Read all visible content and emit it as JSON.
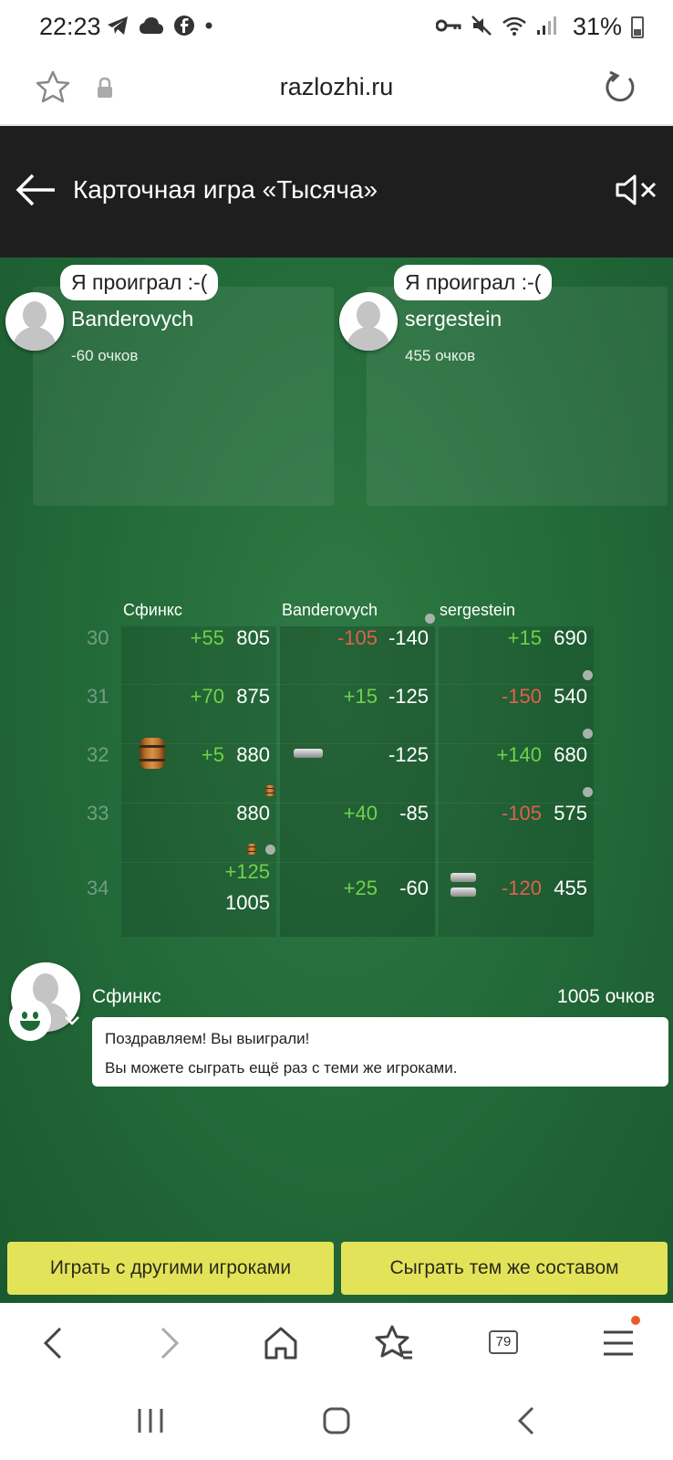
{
  "status_bar": {
    "time": "22:23",
    "battery": "31%"
  },
  "browser": {
    "domain": "razlozhi.ru",
    "tab_count": "79"
  },
  "app": {
    "title": "Карточная игра «Тысяча»"
  },
  "opponents": [
    {
      "bubble": "Я проиграл :-(",
      "name": "Banderovych",
      "score": "-60 очков"
    },
    {
      "bubble": "Я проиграл :-(",
      "name": "sergestein",
      "score": "455 очков"
    }
  ],
  "score_table": {
    "columns": [
      "Сфинкс",
      "Banderovych",
      "sergestein"
    ],
    "rows": [
      {
        "round": "30",
        "cells": [
          {
            "delta": "+55",
            "total": "805"
          },
          {
            "delta": "-105",
            "total": "-140"
          },
          {
            "delta": "+15",
            "total": "690"
          }
        ]
      },
      {
        "round": "31",
        "cells": [
          {
            "delta": "+70",
            "total": "875"
          },
          {
            "delta": "+15",
            "total": "-125"
          },
          {
            "delta": "-150",
            "total": "540"
          }
        ]
      },
      {
        "round": "32",
        "cells": [
          {
            "delta": "+5",
            "total": "880"
          },
          {
            "delta": "",
            "total": "-125"
          },
          {
            "delta": "+140",
            "total": "680"
          }
        ]
      },
      {
        "round": "33",
        "cells": [
          {
            "delta": "",
            "total": "880"
          },
          {
            "delta": "+40",
            "total": "-85"
          },
          {
            "delta": "-105",
            "total": "575"
          }
        ]
      },
      {
        "round": "34",
        "cells": [
          {
            "delta": "+125",
            "total": "1005"
          },
          {
            "delta": "+25",
            "total": "-60"
          },
          {
            "delta": "-120",
            "total": "455"
          }
        ]
      }
    ]
  },
  "winner": {
    "name": "Сфинкс",
    "score": "1005 очков",
    "message_line1": "Поздравляем! Вы выиграли!",
    "message_line2": "Вы можете сыграть ещё раз с теми же игроками."
  },
  "buttons": {
    "play_others": "Играть с другими игроками",
    "play_same": "Сыграть тем же составом"
  },
  "colors": {
    "accent_button": "#e3e35a",
    "table_green": "#226938",
    "positive": "#6fd24b",
    "negative": "#e0604e"
  }
}
